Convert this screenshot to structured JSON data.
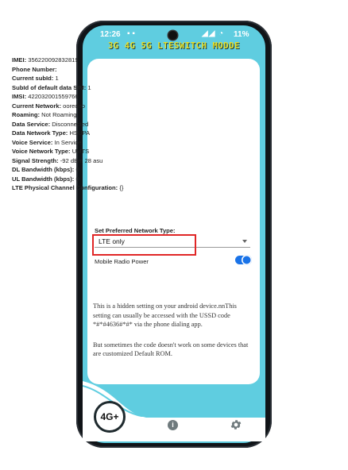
{
  "status_bar": {
    "time": "12:26",
    "battery": "11%"
  },
  "app_title": "3G 4G 5G LTESWITCH MODDE",
  "phone_info": [
    {
      "label": "IMEI:",
      "value": "356220092832819"
    },
    {
      "label": "Phone Number:",
      "value": ""
    },
    {
      "label": "Current subId:",
      "value": "1"
    },
    {
      "label": "SubId of default data SIM:",
      "value": "1"
    },
    {
      "label": "IMSI:",
      "value": "422032001559766"
    },
    {
      "label": "Current Network:",
      "value": "ooredoo"
    },
    {
      "label": "Roaming:",
      "value": "Not Roaming"
    },
    {
      "label": "Data Service:",
      "value": "Disconnected"
    },
    {
      "label": "Data Network Type:",
      "value": "HSUPA"
    },
    {
      "label": "Voice Service:",
      "value": "In Service"
    },
    {
      "label": "Voice Network Type:",
      "value": "UMTS"
    },
    {
      "label": "Signal Strength:",
      "value": "-92 dBm   28 asu"
    },
    {
      "label": "DL Bandwidth (kbps):",
      "value": "0"
    },
    {
      "label": "UL Bandwidth (kbps):",
      "value": "0"
    },
    {
      "label": "LTE Physical Channel Configuration:",
      "value": "{}"
    }
  ],
  "preferred_network": {
    "label": "Set Preferred Network Type:",
    "selected": "LTE only"
  },
  "mobile_radio": {
    "label": "Mobile Radio Power",
    "enabled": true
  },
  "description": {
    "para1": "This is a hidden setting on your android device.nnThis setting can usually be accessed with the USSD code *#*#4636#*#* via the phone dialing app.",
    "para2": "But sometimes the code doesn't work on some devices that are customized Default ROM."
  },
  "bottom_nav": {
    "badge": "4G+",
    "info_glyph": "i"
  },
  "colors": {
    "screen_bg": "#5fcde0",
    "title": "#e7e02a",
    "highlight": "#e02626",
    "toggle": "#1a73e8"
  }
}
